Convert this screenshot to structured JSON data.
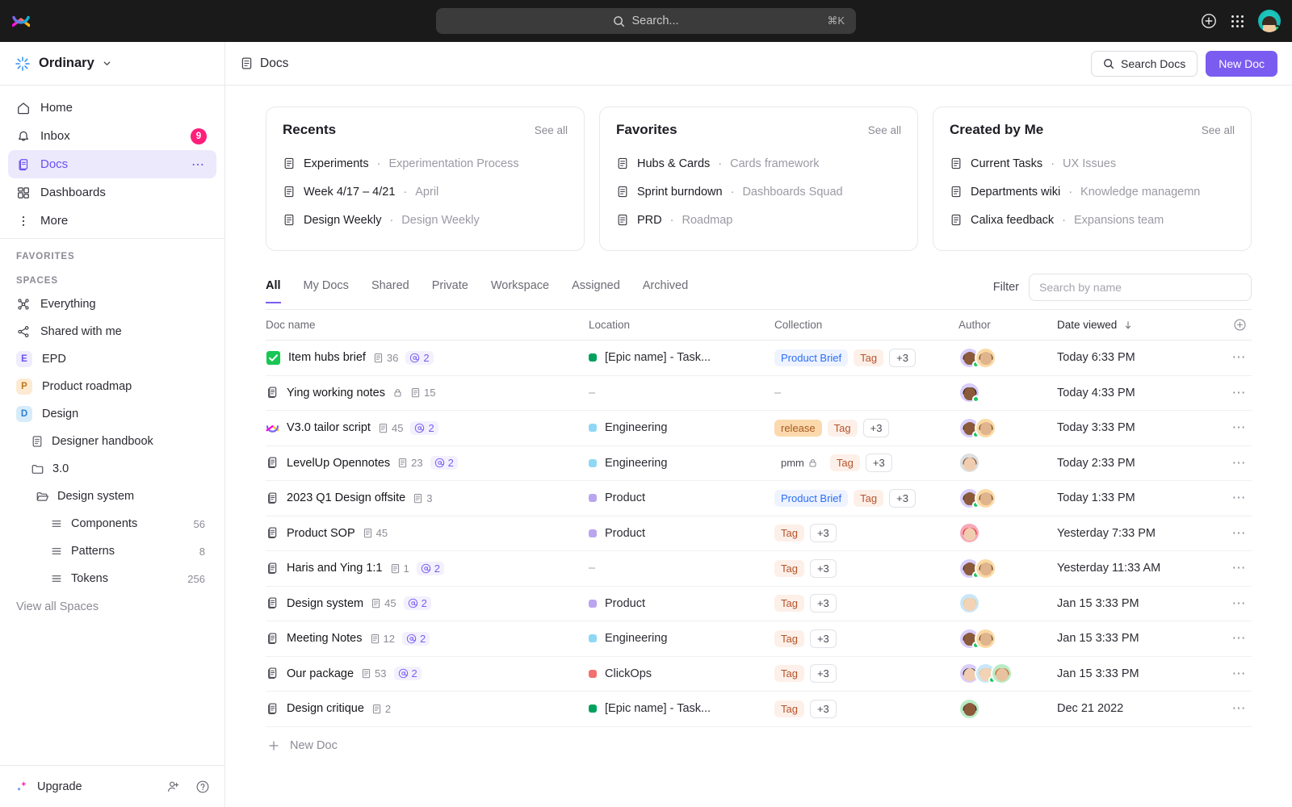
{
  "topbar": {
    "search_placeholder": "Search...",
    "search_shortcut": "⌘K",
    "add_icon": "plus-circle-icon",
    "apps_icon": "apps-grid-icon",
    "avatar_icon": "user-avatar"
  },
  "sidebar": {
    "workspace": "Ordinary",
    "nav": [
      {
        "label": "Home",
        "icon": "home-icon"
      },
      {
        "label": "Inbox",
        "icon": "bell-icon",
        "badge": "9"
      },
      {
        "label": "Docs",
        "icon": "docs-icon",
        "active": true,
        "menu": "⋯"
      },
      {
        "label": "Dashboards",
        "icon": "dashboards-icon"
      },
      {
        "label": "More",
        "icon": "more-vertical-icon"
      }
    ],
    "favorites_label": "FAVORITES",
    "spaces_label": "SPACES",
    "spaces": [
      {
        "label": "Everything",
        "icon": "everything-icon"
      },
      {
        "label": "Shared with me",
        "icon": "share-icon"
      },
      {
        "label": "EPD",
        "initial": "E",
        "color": "#6a4ff0",
        "bg": "#efecfe"
      },
      {
        "label": "Product roadmap",
        "initial": "P",
        "color": "#c2751c",
        "bg": "#fcebd2"
      },
      {
        "label": "Design",
        "initial": "D",
        "color": "#2b7fd4",
        "bg": "#d7ecfa"
      }
    ],
    "tree": [
      {
        "label": "Designer handbook",
        "icon": "doc-icon",
        "indent": 1
      },
      {
        "label": "3.0",
        "icon": "folder-icon",
        "indent": 1
      },
      {
        "label": "Design system",
        "icon": "folder-open-icon",
        "indent": 1
      },
      {
        "label": "Components",
        "icon": "list-icon",
        "indent": 2,
        "count": "56"
      },
      {
        "label": "Patterns",
        "icon": "list-icon",
        "indent": 2,
        "count": "8"
      },
      {
        "label": "Tokens",
        "icon": "list-icon",
        "indent": 2,
        "count": "256"
      }
    ],
    "view_all": "View all Spaces",
    "footer": {
      "upgrade": "Upgrade",
      "invite_icon": "user-plus-icon",
      "help_icon": "help-circle-icon"
    }
  },
  "header": {
    "title": "Docs",
    "title_icon": "doc-icon",
    "search_docs": "Search Docs",
    "new_doc": "New Doc",
    "accent": "#7b5cf0"
  },
  "cards": [
    {
      "title": "Recents",
      "see_all": "See all",
      "rows": [
        {
          "name": "Experiments",
          "sub": "Experimentation Process"
        },
        {
          "name": "Week 4/17 – 4/21",
          "sub": "April"
        },
        {
          "name": "Design Weekly",
          "sub": "Design Weekly"
        }
      ]
    },
    {
      "title": "Favorites",
      "see_all": "See all",
      "rows": [
        {
          "name": "Hubs & Cards",
          "sub": "Cards framework"
        },
        {
          "name": "Sprint burndown",
          "sub": "Dashboards Squad"
        },
        {
          "name": "PRD",
          "sub": "Roadmap"
        }
      ]
    },
    {
      "title": "Created by Me",
      "see_all": "See all",
      "rows": [
        {
          "name": "Current Tasks",
          "sub": "UX Issues"
        },
        {
          "name": "Departments wiki",
          "sub": "Knowledge managemn"
        },
        {
          "name": "Calixa feedback",
          "sub": "Expansions team"
        }
      ]
    }
  ],
  "tabs": [
    {
      "label": "All",
      "active": true
    },
    {
      "label": "My Docs"
    },
    {
      "label": "Shared"
    },
    {
      "label": "Private"
    },
    {
      "label": "Workspace"
    },
    {
      "label": "Assigned"
    },
    {
      "label": "Archived"
    }
  ],
  "filter": {
    "label": "Filter",
    "placeholder": "Search by name",
    "value": ""
  },
  "table": {
    "columns": {
      "name": "Doc name",
      "location": "Location",
      "collection": "Collection",
      "author": "Author",
      "date": "Date viewed",
      "sort_icon": "arrow-down-icon",
      "add_column_icon": "plus-circle-icon"
    },
    "new_doc": "New Doc",
    "rows": [
      {
        "icon": "checkbox-green-icon",
        "name": "Item hubs brief",
        "pages": "36",
        "mentions": "2",
        "locked": false,
        "loc": "[Epic name] - Task...",
        "loc_color": "#00a15c",
        "chips": [
          {
            "text": "Product Brief",
            "style": "blue"
          },
          {
            "text": "Tag",
            "style": "tag"
          },
          {
            "text": "+3",
            "style": "plain"
          }
        ],
        "avatars": [
          {
            "bg": "#d9cdfb",
            "skin": "#8a5a3b",
            "hair": "#2b1a12",
            "online": true
          },
          {
            "bg": "#fbd9a3",
            "skin": "#e0b48c",
            "hair": "#3a2318"
          }
        ],
        "date": "Today 6:33 PM"
      },
      {
        "icon": "doc-icon",
        "name": "Ying working notes",
        "pages": "15",
        "mentions": "",
        "locked": true,
        "loc": "",
        "loc_color": "",
        "chips": [],
        "avatars": [
          {
            "bg": "#d9cdfb",
            "skin": "#8a5a3b",
            "hair": "#2b1a12",
            "online": true
          }
        ],
        "date": "Today 4:33 PM"
      },
      {
        "icon": "clickup-icon",
        "name": "V3.0 tailor script",
        "pages": "45",
        "mentions": "2",
        "locked": false,
        "loc": "Engineering",
        "loc_color": "#8fd7f5",
        "chips": [
          {
            "text": "release",
            "style": "release"
          },
          {
            "text": "Tag",
            "style": "tag"
          },
          {
            "text": "+3",
            "style": "plain"
          }
        ],
        "avatars": [
          {
            "bg": "#d9cdfb",
            "skin": "#8a5a3b",
            "hair": "#2b1a12",
            "online": true
          },
          {
            "bg": "#fbd9a3",
            "skin": "#e0b48c",
            "hair": "#3a2318"
          }
        ],
        "date": "Today 3:33 PM"
      },
      {
        "icon": "doc-icon",
        "name": "LevelUp Opennotes",
        "pages": "23",
        "mentions": "2",
        "locked": false,
        "loc": "Engineering",
        "loc_color": "#8fd7f5",
        "chips": [
          {
            "text": "pmm",
            "style": "pmm",
            "lock": true
          },
          {
            "text": "Tag",
            "style": "tag"
          },
          {
            "text": "+3",
            "style": "plain"
          }
        ],
        "avatars": [
          {
            "bg": "#dedede",
            "skin": "#f0cdb0",
            "hair": "#6b4a33"
          }
        ],
        "date": "Today 2:33 PM"
      },
      {
        "icon": "doc-icon",
        "name": "2023 Q1 Design offsite",
        "pages": "3",
        "mentions": "",
        "locked": false,
        "loc": "Product",
        "loc_color": "#b9a6ef",
        "chips": [
          {
            "text": "Product Brief",
            "style": "blue"
          },
          {
            "text": "Tag",
            "style": "tag"
          },
          {
            "text": "+3",
            "style": "plain"
          }
        ],
        "avatars": [
          {
            "bg": "#d9cdfb",
            "skin": "#8a5a3b",
            "hair": "#2b1a12",
            "online": true
          },
          {
            "bg": "#fbd9a3",
            "skin": "#e0b48c",
            "hair": "#3a2318"
          }
        ],
        "date": "Today 1:33 PM"
      },
      {
        "icon": "doc-icon",
        "name": "Product SOP",
        "pages": "45",
        "mentions": "",
        "locked": false,
        "loc": "Product",
        "loc_color": "#b9a6ef",
        "chips": [
          {
            "text": "Tag",
            "style": "tag"
          },
          {
            "text": "+3",
            "style": "plain"
          }
        ],
        "avatars": [
          {
            "bg": "#f7a8b8",
            "skin": "#f0cdb0",
            "hair": "#e01e2b"
          }
        ],
        "date": "Yesterday 7:33 PM"
      },
      {
        "icon": "doc-icon",
        "name": "Haris and Ying 1:1",
        "pages": "1",
        "mentions": "2",
        "locked": false,
        "loc": "",
        "loc_color": "",
        "chips": [
          {
            "text": "Tag",
            "style": "tag"
          },
          {
            "text": "+3",
            "style": "plain"
          }
        ],
        "avatars": [
          {
            "bg": "#d9cdfb",
            "skin": "#8a5a3b",
            "hair": "#2b1a12",
            "online": true
          },
          {
            "bg": "#fbd9a3",
            "skin": "#e0b48c",
            "hair": "#3a2318"
          }
        ],
        "date": "Yesterday 11:33 AM"
      },
      {
        "icon": "doc-icon",
        "name": "Design system",
        "pages": "45",
        "mentions": "2",
        "locked": false,
        "loc": "Product",
        "loc_color": "#b9a6ef",
        "chips": [
          {
            "text": "Tag",
            "style": "tag"
          },
          {
            "text": "+3",
            "style": "plain"
          }
        ],
        "avatars": [
          {
            "bg": "#c8e7f8",
            "skin": "#f3d3b6",
            "hair": "#e8c98a"
          }
        ],
        "date": "Jan 15 3:33 PM"
      },
      {
        "icon": "doc-icon",
        "name": "Meeting Notes",
        "pages": "12",
        "mentions": "2",
        "locked": false,
        "loc": "Engineering",
        "loc_color": "#8fd7f5",
        "chips": [
          {
            "text": "Tag",
            "style": "tag"
          },
          {
            "text": "+3",
            "style": "plain"
          }
        ],
        "avatars": [
          {
            "bg": "#d9cdfb",
            "skin": "#8a5a3b",
            "hair": "#2b1a12",
            "online": true
          },
          {
            "bg": "#fbd9a3",
            "skin": "#e0b48c",
            "hair": "#3a2318"
          }
        ],
        "date": "Jan 15 3:33 PM"
      },
      {
        "icon": "doc-icon",
        "name": "Our package",
        "pages": "53",
        "mentions": "2",
        "locked": false,
        "loc": "ClickOps",
        "loc_color": "#f2706f",
        "chips": [
          {
            "text": "Tag",
            "style": "tag"
          },
          {
            "text": "+3",
            "style": "plain"
          }
        ],
        "avatars": [
          {
            "bg": "#d9cdfb",
            "skin": "#f0cdb0",
            "hair": "#1d1a1f"
          },
          {
            "bg": "#c8e7f8",
            "skin": "#f3d3b6",
            "hair": "#e8c98a",
            "online": true
          },
          {
            "bg": "#b9ecc4",
            "skin": "#e8c2a0",
            "hair": "#c2521e"
          }
        ],
        "date": "Jan 15 3:33 PM"
      },
      {
        "icon": "doc-icon",
        "name": "Design critique",
        "pages": "2",
        "mentions": "",
        "locked": false,
        "loc": "[Epic name] - Task...",
        "loc_color": "#00a15c",
        "chips": [
          {
            "text": "Tag",
            "style": "tag"
          },
          {
            "text": "+3",
            "style": "plain"
          }
        ],
        "avatars": [
          {
            "bg": "#b9ecc4",
            "skin": "#8a5a3b",
            "hair": "#2b1a12"
          }
        ],
        "date": "Dec 21 2022"
      }
    ]
  }
}
